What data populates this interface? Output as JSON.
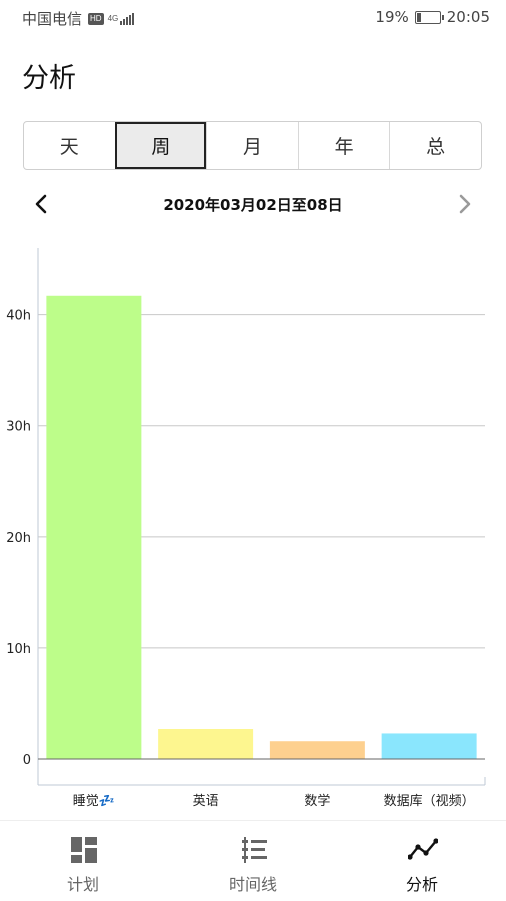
{
  "status_bar": {
    "carrier": "中国电信",
    "hd_badge": "HD",
    "network": "4G",
    "battery_percent": "19%",
    "battery_level": 0.19,
    "time": "20:05"
  },
  "page": {
    "title": "分析"
  },
  "period_tabs": {
    "items": [
      "天",
      "周",
      "月",
      "年",
      "总"
    ],
    "selected": "周"
  },
  "date_nav": {
    "range": "2020年03月02日至08日"
  },
  "chart_data": {
    "type": "bar",
    "categories": [
      "睡觉💤",
      "英语",
      "数学",
      "数据库（视频）"
    ],
    "values": [
      41.7,
      2.7,
      1.6,
      2.3
    ],
    "colors": [
      "#bdfd8a",
      "#fdf68f",
      "#fdd08f",
      "#8ae6fd"
    ],
    "ylim": [
      0,
      46
    ],
    "ticks": [
      {
        "value": 0,
        "label": "0"
      },
      {
        "value": 10,
        "label": "10h"
      },
      {
        "value": 20,
        "label": "20h"
      },
      {
        "value": 30,
        "label": "30h"
      },
      {
        "value": 40,
        "label": "40h"
      }
    ],
    "grid": true,
    "xlabel": "",
    "ylabel": ""
  },
  "bottom_nav": {
    "items": [
      {
        "label": "计划",
        "icon": "dashboard-icon"
      },
      {
        "label": "时间线",
        "icon": "timeline-icon"
      },
      {
        "label": "分析",
        "icon": "analytics-icon"
      }
    ],
    "active": "分析"
  }
}
